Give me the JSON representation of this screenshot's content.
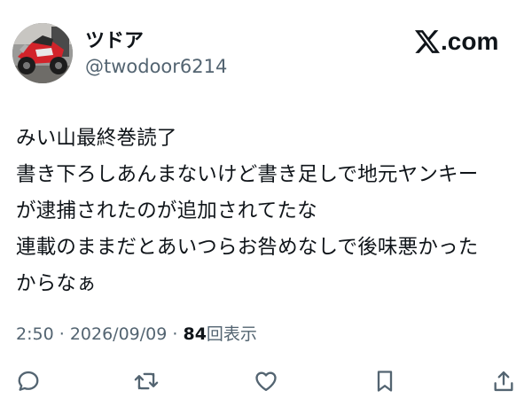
{
  "user": {
    "display_name": "ツドア",
    "handle": "@twodoor6214"
  },
  "brand": {
    "logo_icon": "x-logo-icon",
    "logo_text": ".com"
  },
  "tweet": {
    "lines": [
      "みい山最終巻読了",
      "書き下ろしあんまないけど書き足しで地元ヤンキー",
      "が逮捕されたのが追加されてたな",
      "連載のままだとあいつらお咎めなしで後味悪かった",
      "からなぁ"
    ]
  },
  "meta": {
    "time": "2:50",
    "separator": "·",
    "date": "2026/09/09",
    "views_count": "84",
    "views_label": "回表示"
  },
  "actions": {
    "icons": [
      "reply-icon",
      "retweet-icon",
      "like-icon",
      "bookmark-icon",
      "share-icon"
    ]
  },
  "colors": {
    "text": "#0f1419",
    "secondary": "#536471",
    "background": "#ffffff"
  }
}
